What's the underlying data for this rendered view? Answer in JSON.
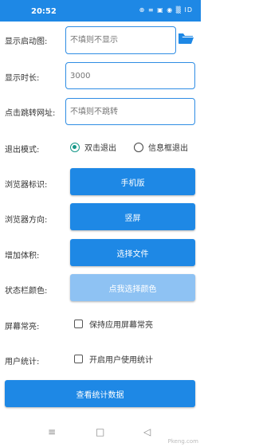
{
  "status_bar": {
    "time": "20:52",
    "indicators": "⊕ ≡ ▣ ◉ ▒ ID"
  },
  "form": {
    "splash_image": {
      "label": "显示启动图:",
      "placeholder": "不填则不显示",
      "icon": "folder-icon"
    },
    "duration": {
      "label": "显示时长:",
      "placeholder": "3000"
    },
    "redirect_url": {
      "label": "点击跳转网址:",
      "placeholder": "不填则不跳转"
    },
    "exit_mode": {
      "label": "退出模式:",
      "options": [
        "双击退出",
        "信息框退出"
      ],
      "selected": "双击退出"
    },
    "browser_id": {
      "label": "浏览器标识:",
      "button": "手机版"
    },
    "browser_orientation": {
      "label": "浏览器方向:",
      "button": "竖屏"
    },
    "add_volume": {
      "label": "增加体积:",
      "button": "选择文件"
    },
    "statusbar_color": {
      "label": "状态栏颜色:",
      "button": "点我选择颜色"
    },
    "screen_on": {
      "label": "屏幕常亮:",
      "checkbox": "保持应用屏幕常亮",
      "checked": false
    },
    "user_stats": {
      "label": "用户统计:",
      "checkbox": "开启用户使用统计",
      "checked": false
    }
  },
  "actions": {
    "view_stats": "查看统计数据"
  },
  "nav": {
    "menu": "≡",
    "home": "□",
    "back": "◁"
  },
  "watermark": "Pkeng.com",
  "colors": {
    "primary": "#1e88e5",
    "primary_disabled": "#8ec2f3",
    "radio_accent": "#159788"
  }
}
